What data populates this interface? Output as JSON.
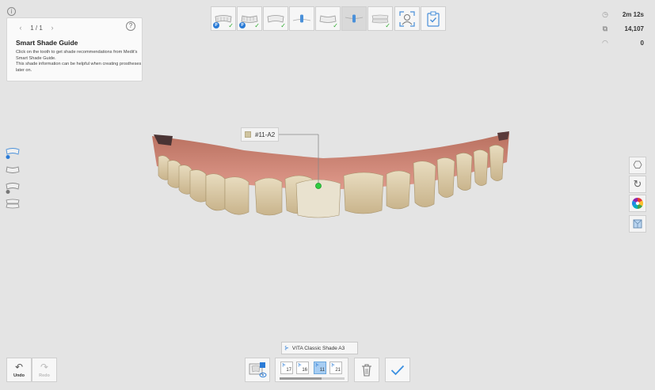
{
  "info_icon": "i",
  "guide": {
    "pager": {
      "prev": "‹",
      "count": "1 / 1",
      "next": "›"
    },
    "help": "?",
    "title": "Smart Shade Guide",
    "line1": "Click on the tooth to get shade recommendations from Medit's Smart Shade Guide.",
    "line2": "This shade information can be helpful when creating prostheses later on."
  },
  "stats": {
    "time": {
      "icon": "clock-icon",
      "value": "2m 12s"
    },
    "count": {
      "icon": "layers-icon",
      "value": "14,107"
    },
    "wifi": {
      "icon": "wifi-icon",
      "value": "0"
    }
  },
  "scan": {
    "tooth_label": "#11-A2",
    "swatch_color": "#cfc4a0"
  },
  "shade_chip": "VITA Classic Shade A3",
  "undo_label": "Undo",
  "redo_label": "Redo",
  "teeth": [
    {
      "num": "17",
      "selected": false
    },
    {
      "num": "16",
      "selected": false
    },
    {
      "num": "11",
      "selected": true
    },
    {
      "num": "21",
      "selected": false
    }
  ],
  "tooth_progress": 0.65,
  "colors": {
    "accent": "#2a7bd6",
    "check": "#2aa82a",
    "marker": "#2ecc40"
  }
}
